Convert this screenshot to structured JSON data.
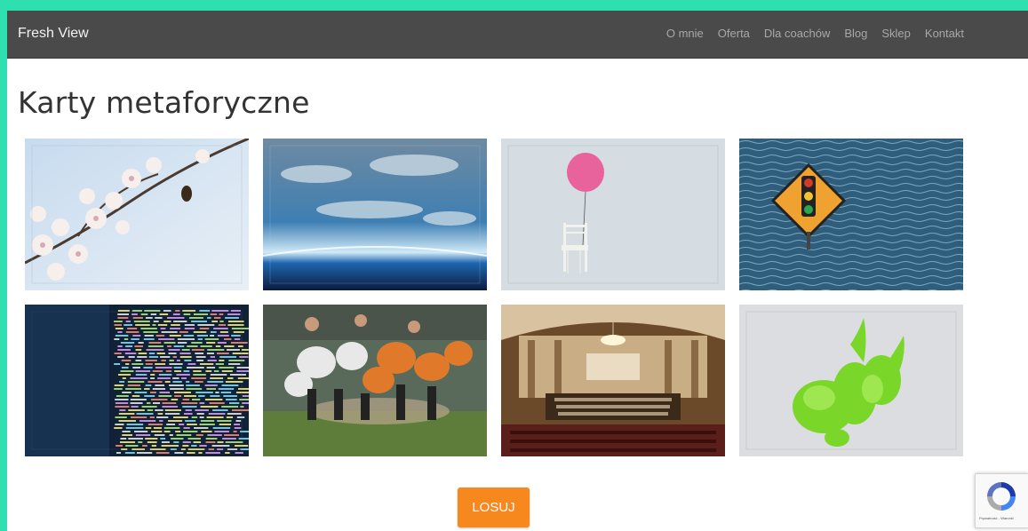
{
  "header": {
    "brand": "Fresh View",
    "nav": [
      "O mnie",
      "Oferta",
      "Dla coachów",
      "Blog",
      "Sklep",
      "Kontakt"
    ]
  },
  "main": {
    "title": "Karty metaforyczne",
    "cards": [
      {
        "icon": "cherry-blossom-photo"
      },
      {
        "icon": "earth-horizon-photo"
      },
      {
        "icon": "balloon-chair-photo"
      },
      {
        "icon": "traffic-sign-water-photo"
      },
      {
        "icon": "code-screen-photo"
      },
      {
        "icon": "rugby-scrum-photo"
      },
      {
        "icon": "concert-hall-photo"
      },
      {
        "icon": "green-ink-photo"
      }
    ],
    "button_label": "LOSUJ"
  },
  "recaptcha": {
    "icon": "recaptcha-icon",
    "text": "Prywatność - Warunki"
  },
  "colors": {
    "frame": "#2ee0b0",
    "navbar": "#4a4a4a",
    "button": "#f7881e"
  }
}
